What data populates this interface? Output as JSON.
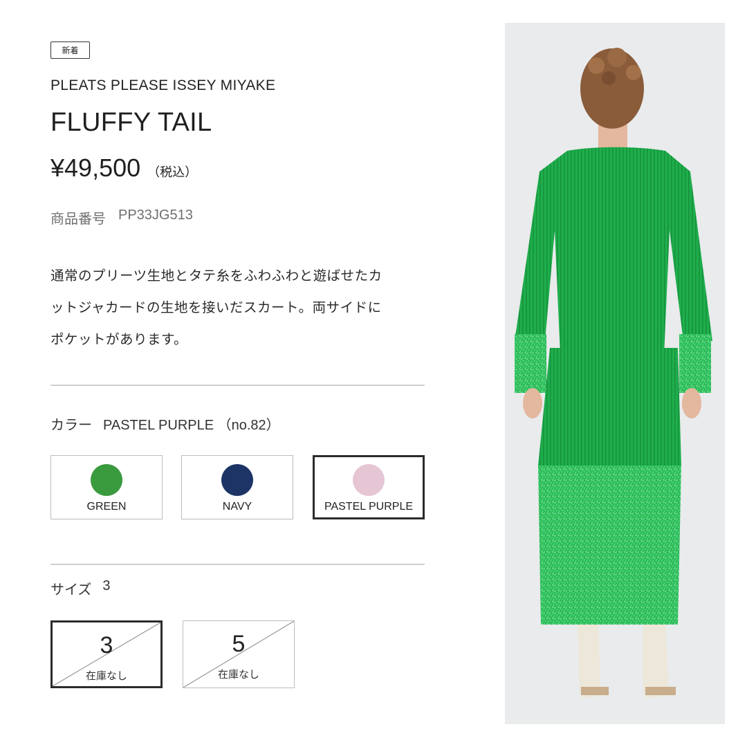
{
  "badge": "新着",
  "brand": "PLEATS PLEASE ISSEY MIYAKE",
  "title": "FLUFFY TAIL",
  "price": {
    "value": "¥49,500",
    "tax": "（税込）"
  },
  "product_number": {
    "label": "商品番号",
    "value": "PP33JG513"
  },
  "description": [
    "通常のプリーツ生地とタテ糸をふわふわと遊ばせたカ",
    "ットジャカードの生地を接いだスカート。両サイドに",
    "ポケットがあります。"
  ],
  "color_section": {
    "label": "カラー",
    "selected": "PASTEL PURPLE （no.82）",
    "options": [
      {
        "name": "GREEN",
        "color": "#3a9a3e"
      },
      {
        "name": "NAVY",
        "color": "#1c3566"
      },
      {
        "name": "PASTEL PURPLE",
        "color": "#e6c6d5"
      }
    ]
  },
  "size_section": {
    "label": "サイズ",
    "selected": "3",
    "options": [
      {
        "size": "3",
        "stock": "在庫なし"
      },
      {
        "size": "5",
        "stock": "在庫なし"
      }
    ]
  }
}
